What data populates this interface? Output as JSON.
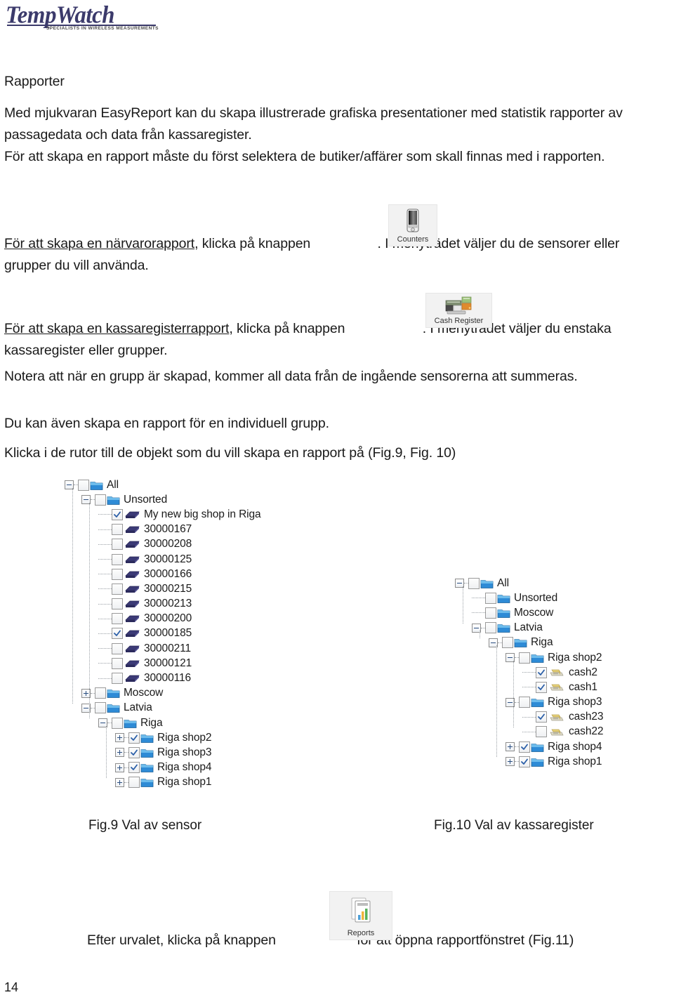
{
  "logo": {
    "wordmark": "TempWatch",
    "tagline": "SPECIALISTS IN WIRELESS MEASUREMENTS",
    "color": "#3b3a6b"
  },
  "document": {
    "heading": "Rapporter",
    "paragraphs": {
      "intro": "Med mjukvaran EasyReport kan du skapa illustrerade grafiska presentationer med statistik rapporter av passagedata och data från kassaregister.",
      "create": "För att skapa en rapport måste du först selektera de butiker/affärer som skall finnas med i rapporten.",
      "attendance_link": "För att skapa en närvarorapport",
      "attendance_before": ", klicka på knappen",
      "attendance_after": ". I menyträdet väljer du de sensorer eller grupper du vill använda.",
      "cashreg_link": "För att skapa en kassaregisterrapport",
      "cashreg_before": ", klicka på knappen",
      "cashreg_after": ". I menyträdet väljer du enstaka kassaregister eller grupper.",
      "note": "Notera att när en grupp är skapad, kommer all data från de ingående sensorerna att summeras.",
      "individual": "Du kan även skapa en rapport för en individuell grupp.",
      "click": "Klicka i de rutor till de objekt som du vill skapa en rapport på (Fig.9, Fig. 10)",
      "after_before": "Efter urvalet, klicka på knappen",
      "after_after": "för att öppna rapportfönstret (Fig.11)"
    },
    "page_number": "14"
  },
  "buttons": {
    "counters": {
      "label": "Counters",
      "icon": "counter-device-icon"
    },
    "cash_register": {
      "label": "Cash Register",
      "icon": "cash-register-icon"
    },
    "reports": {
      "label": "Reports",
      "icon": "report-chart-icon"
    }
  },
  "captions": {
    "fig9": "Fig.9 Val av sensor",
    "fig10": "Fig.10 Val av kassaregister"
  },
  "tree_sensors": {
    "nodes": [
      {
        "label": "All",
        "depth": 0,
        "icon": "folder",
        "checked": false,
        "expander": "minus"
      },
      {
        "label": "Unsorted",
        "depth": 1,
        "icon": "folder",
        "checked": false,
        "expander": "minus"
      },
      {
        "label": "My new big shop in Riga",
        "depth": 2,
        "icon": "sensor",
        "checked": true,
        "expander": "none"
      },
      {
        "label": "30000167",
        "depth": 2,
        "icon": "sensor",
        "checked": false,
        "expander": "none"
      },
      {
        "label": "30000208",
        "depth": 2,
        "icon": "sensor",
        "checked": false,
        "expander": "none"
      },
      {
        "label": "30000125",
        "depth": 2,
        "icon": "sensor",
        "checked": false,
        "expander": "none"
      },
      {
        "label": "30000166",
        "depth": 2,
        "icon": "sensor",
        "checked": false,
        "expander": "none"
      },
      {
        "label": "30000215",
        "depth": 2,
        "icon": "sensor",
        "checked": false,
        "expander": "none"
      },
      {
        "label": "30000213",
        "depth": 2,
        "icon": "sensor",
        "checked": false,
        "expander": "none"
      },
      {
        "label": "30000200",
        "depth": 2,
        "icon": "sensor",
        "checked": false,
        "expander": "none"
      },
      {
        "label": "30000185",
        "depth": 2,
        "icon": "sensor",
        "checked": true,
        "expander": "none"
      },
      {
        "label": "30000211",
        "depth": 2,
        "icon": "sensor",
        "checked": false,
        "expander": "none"
      },
      {
        "label": "30000121",
        "depth": 2,
        "icon": "sensor",
        "checked": false,
        "expander": "none"
      },
      {
        "label": "30000116",
        "depth": 2,
        "icon": "sensor",
        "checked": false,
        "expander": "none"
      },
      {
        "label": "Moscow",
        "depth": 1,
        "icon": "folder",
        "checked": false,
        "expander": "plus"
      },
      {
        "label": "Latvia",
        "depth": 1,
        "icon": "folder",
        "checked": false,
        "expander": "minus"
      },
      {
        "label": "Riga",
        "depth": 2,
        "icon": "folder",
        "checked": false,
        "expander": "minus"
      },
      {
        "label": "Riga shop2",
        "depth": 3,
        "icon": "folder",
        "checked": true,
        "expander": "plus"
      },
      {
        "label": "Riga shop3",
        "depth": 3,
        "icon": "folder",
        "checked": true,
        "expander": "plus"
      },
      {
        "label": "Riga shop4",
        "depth": 3,
        "icon": "folder",
        "checked": true,
        "expander": "plus"
      },
      {
        "label": "Riga shop1",
        "depth": 3,
        "icon": "folder",
        "checked": false,
        "expander": "plus"
      }
    ]
  },
  "tree_cashregisters": {
    "nodes": [
      {
        "label": "All",
        "depth": 0,
        "icon": "folder",
        "checked": false,
        "expander": "minus"
      },
      {
        "label": "Unsorted",
        "depth": 1,
        "icon": "folder",
        "checked": false,
        "expander": "none"
      },
      {
        "label": "Moscow",
        "depth": 1,
        "icon": "folder",
        "checked": false,
        "expander": "none"
      },
      {
        "label": "Latvia",
        "depth": 1,
        "icon": "folder",
        "checked": false,
        "expander": "minus"
      },
      {
        "label": "Riga",
        "depth": 2,
        "icon": "folder",
        "checked": false,
        "expander": "minus"
      },
      {
        "label": "Riga shop2",
        "depth": 3,
        "icon": "folder",
        "checked": false,
        "expander": "minus"
      },
      {
        "label": "cash2",
        "depth": 4,
        "icon": "cashreg",
        "checked": true,
        "expander": "none"
      },
      {
        "label": "cash1",
        "depth": 4,
        "icon": "cashreg",
        "checked": true,
        "expander": "none"
      },
      {
        "label": "Riga shop3",
        "depth": 3,
        "icon": "folder",
        "checked": false,
        "expander": "minus"
      },
      {
        "label": "cash23",
        "depth": 4,
        "icon": "cashreg",
        "checked": true,
        "expander": "none"
      },
      {
        "label": "cash22",
        "depth": 4,
        "icon": "cashreg",
        "checked": false,
        "expander": "none"
      },
      {
        "label": "Riga shop4",
        "depth": 3,
        "icon": "folder",
        "checked": true,
        "expander": "plus"
      },
      {
        "label": "Riga shop1",
        "depth": 3,
        "icon": "folder",
        "checked": true,
        "expander": "plus"
      }
    ]
  }
}
